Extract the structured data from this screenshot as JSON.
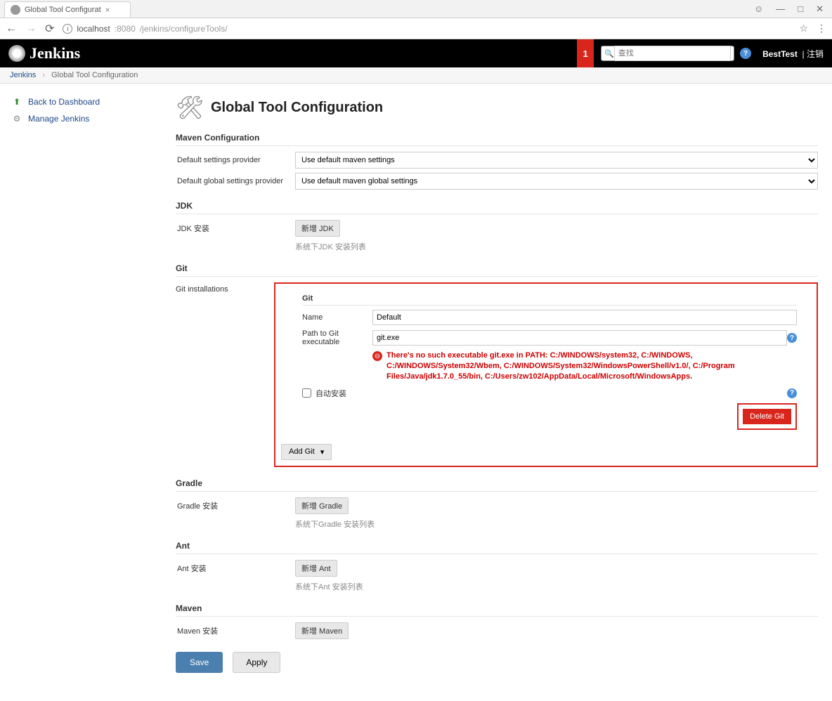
{
  "browser": {
    "tab_title": "Global Tool Configurat",
    "url_host": "localhost",
    "url_port": ":8080",
    "url_path": "/jenkins/configureTools/"
  },
  "header": {
    "app_name": "Jenkins",
    "notif_count": "1",
    "search_placeholder": "查找",
    "user": "BestTest",
    "logout": "注销"
  },
  "breadcrumb": {
    "a": "Jenkins",
    "b": "Global Tool Configuration"
  },
  "sidebar": {
    "back": "Back to Dashboard",
    "manage": "Manage Jenkins"
  },
  "page": {
    "title": "Global Tool Configuration"
  },
  "maven_cfg": {
    "head": "Maven Configuration",
    "label1": "Default settings provider",
    "opt1": "Use default maven settings",
    "label2": "Default global settings provider",
    "opt2": "Use default maven global settings"
  },
  "jdk": {
    "head": "JDK",
    "label": "JDK 安装",
    "btn": "新增 JDK",
    "note": "系统下JDK 安装列表"
  },
  "git": {
    "head": "Git",
    "label": "Git installations",
    "inner_head": "Git",
    "name_label": "Name",
    "name_value": "Default",
    "path_label": "Path to Git executable",
    "path_value": "git.exe",
    "error": "There's no such executable git.exe in PATH: C:/WINDOWS/system32, C:/WINDOWS, C:/WINDOWS/System32/Wbem, C:/WINDOWS/System32/WindowsPowerShell/v1.0/, C:/Program Files/Java/jdk1.7.0_55/bin, C:/Users/zw102/AppData/Local/Microsoft/WindowsApps.",
    "auto": "自动安装",
    "delete": "Delete Git",
    "add": "Add Git"
  },
  "gradle": {
    "head": "Gradle",
    "label": "Gradle 安装",
    "btn": "新增 Gradle",
    "note": "系统下Gradle 安装列表"
  },
  "ant": {
    "head": "Ant",
    "label": "Ant 安装",
    "btn": "新增 Ant",
    "note": "系统下Ant 安装列表"
  },
  "maven": {
    "head": "Maven",
    "label": "Maven 安装",
    "btn": "新增 Maven"
  },
  "footer": {
    "save": "Save",
    "apply": "Apply"
  }
}
